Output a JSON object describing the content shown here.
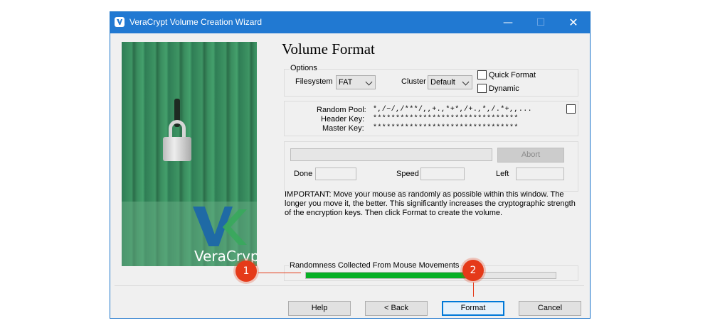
{
  "window": {
    "title": "VeraCrypt Volume Creation Wizard",
    "minimize_glyph": "—",
    "maximize_glyph": "☐",
    "close_glyph": "✕"
  },
  "banner": {
    "brand": "VeraCrypt"
  },
  "page_title": "Volume Format",
  "options": {
    "legend": "Options",
    "filesystem_label": "Filesystem",
    "filesystem_value": "FAT",
    "cluster_label": "Cluster",
    "cluster_value": "Default",
    "quick_format_label": "Quick Format",
    "quick_format_checked": false,
    "dynamic_label": "Dynamic",
    "dynamic_checked": false
  },
  "keys": {
    "random_pool_label": "Random Pool:",
    "random_pool_value": "*,/−/,/***/,,+.,*+*,/+.,*,/.*+,,...",
    "header_key_label": "Header Key:",
    "header_key_value": "********************************",
    "master_key_label": "Master Key:",
    "master_key_value": "********************************",
    "show_checked": false
  },
  "progress": {
    "abort_label": "Abort",
    "done_label": "Done",
    "done_value": "",
    "speed_label": "Speed",
    "speed_value": "",
    "left_label": "Left",
    "left_value": "",
    "fraction": 0
  },
  "notice": "IMPORTANT: Move your mouse as randomly as possible within this window. The longer you move it, the better. This significantly increases the cryptographic strength of the encryption keys. Then click Format to create the volume.",
  "randomness": {
    "legend": "Randomness Collected From Mouse Movements",
    "fraction": 0.66
  },
  "buttons": {
    "help": "Help",
    "back": "< Back",
    "format": "Format",
    "cancel": "Cancel"
  },
  "callouts": {
    "one": "1",
    "two": "2"
  },
  "colors": {
    "accent": "#2179d2",
    "progress_green": "#06b025",
    "callout_red": "#e53a19"
  }
}
